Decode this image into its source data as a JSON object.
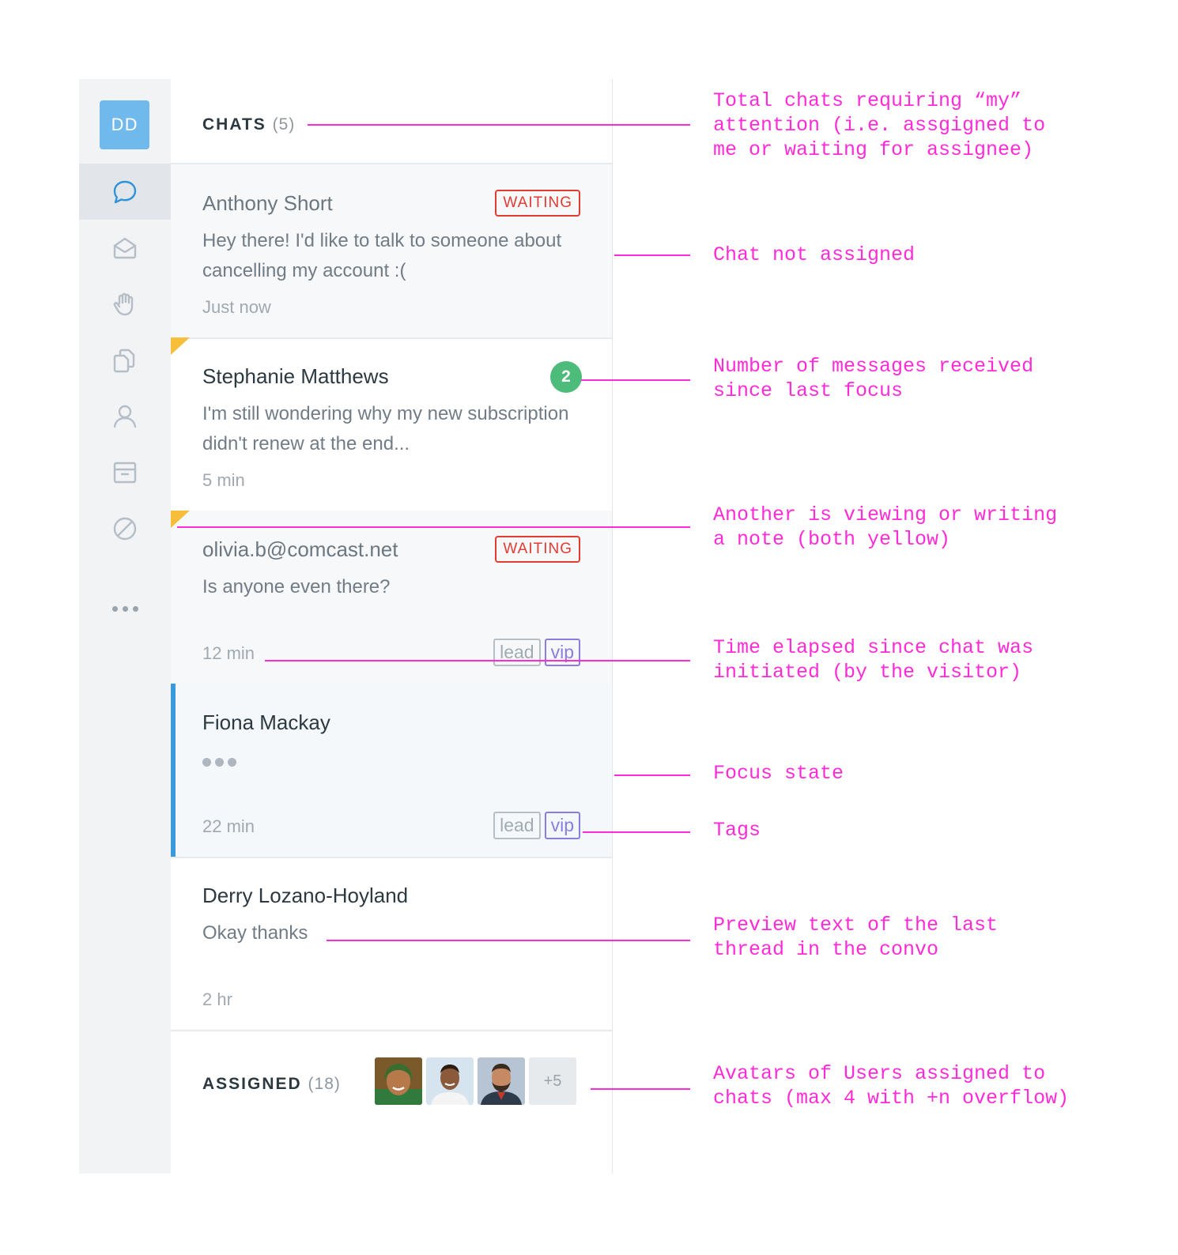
{
  "rail": {
    "user_initials": "DD",
    "accent_color": "#6fb9ed",
    "items": [
      {
        "icon": "chat-bubble-icon",
        "active": true
      },
      {
        "icon": "open-envelope-icon",
        "active": false
      },
      {
        "icon": "raised-hand-icon",
        "active": false
      },
      {
        "icon": "copy-pages-icon",
        "active": false
      },
      {
        "icon": "person-icon",
        "active": false
      },
      {
        "icon": "archive-box-icon",
        "active": false
      },
      {
        "icon": "blocked-icon",
        "active": false
      },
      {
        "icon": "more-icon",
        "active": false
      }
    ]
  },
  "chats_section": {
    "title": "CHATS",
    "count": "(5)"
  },
  "chats": [
    {
      "name": "Anthony Short",
      "preview": "Hey there! I'd like to talk to someone about cancelling my account :(",
      "time": "Just now",
      "badge": "WAITING"
    },
    {
      "name": "Stephanie Matthews",
      "preview": "I'm still wondering why my new subscription didn't renew at the end...",
      "time": "5 min",
      "unread_count": "2"
    },
    {
      "name": "olivia.b@comcast.net",
      "preview": "Is anyone even there?",
      "time": "12 min",
      "badge": "WAITING",
      "tags": [
        "lead",
        "vip"
      ]
    },
    {
      "name": "Fiona Mackay",
      "preview_state": "typing",
      "time": "22 min",
      "tags": [
        "lead",
        "vip"
      ]
    },
    {
      "name": "Derry Lozano-Hoyland",
      "preview": "Okay thanks",
      "time": "2 hr"
    }
  ],
  "assigned_section": {
    "title": "ASSIGNED",
    "count": "(18)",
    "overflow": "+5"
  },
  "annotations": [
    "Total chats requiring “my”\nattention (i.e. assgigned to\nme or waiting for assignee)",
    "Chat not assigned",
    "Number of messages received\nsince last focus",
    "Another is viewing or writing\na note (both yellow)",
    "Time elapsed since chat was\ninitiated (by the visitor)",
    "Focus state",
    "Tags",
    "Preview text of the last\nthread in the convo",
    "Avatars of Users assigned to\nchats (max 4 with +n overflow)"
  ],
  "colors": {
    "annotation": "#ff2bd6",
    "waiting": "#e23b32",
    "unread": "#4dbb79",
    "focus": "#3a99d8",
    "viewing_flag": "#f7be3b",
    "vip_tag": "#8a7de0"
  }
}
